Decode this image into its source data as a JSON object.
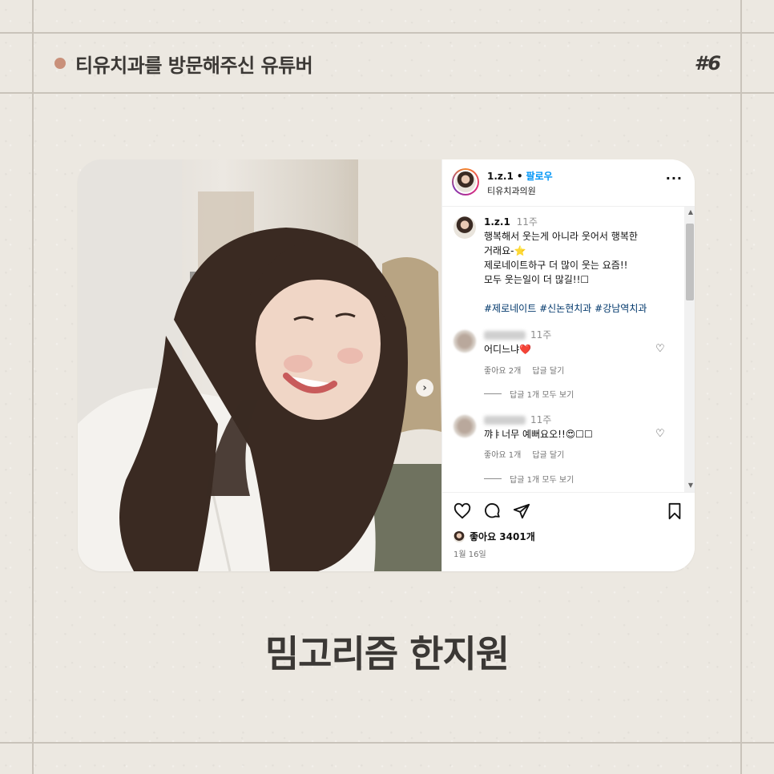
{
  "header": {
    "title": "티유치과를 방문해주신 유튜버",
    "episode": "#6"
  },
  "post": {
    "username": "1.z.1",
    "separator": "•",
    "follow_label": "팔로우",
    "location": "티유치과의원",
    "more_label": "···",
    "caption": {
      "time": "11주",
      "line1": "행복해서 웃는게 아니라 웃어서 행복한",
      "line2": "거래요-⭐",
      "line3": "제로네이트하구 더 많이 웃는 요즘!!",
      "line4": "모두 웃는일이 더 많길!!☐",
      "tags": "#제로네이트 #신논현치과 #강남역치과"
    },
    "comments": [
      {
        "time": "11주",
        "text": "어디느냐❤️",
        "likes": "좋아요 2개",
        "reply_label": "답글 달기",
        "view_replies": "답글 1개 모두 보기"
      },
      {
        "time": "11주",
        "text": "꺄ㅑ너무 예뻐요오!!😍☐☐",
        "likes": "좋아요 1개",
        "reply_label": "답글 달기",
        "view_replies": "답글 1개 모두 보기"
      }
    ],
    "likes_total": "좋아요 3401개",
    "date": "1월 16일"
  },
  "footer": {
    "caption": "밈고리즘 한지원"
  },
  "colors": {
    "background": "#ece8e1",
    "accent_dot": "#c9907a",
    "follow_blue": "#0095f6",
    "hashtag_blue": "#00376b"
  }
}
